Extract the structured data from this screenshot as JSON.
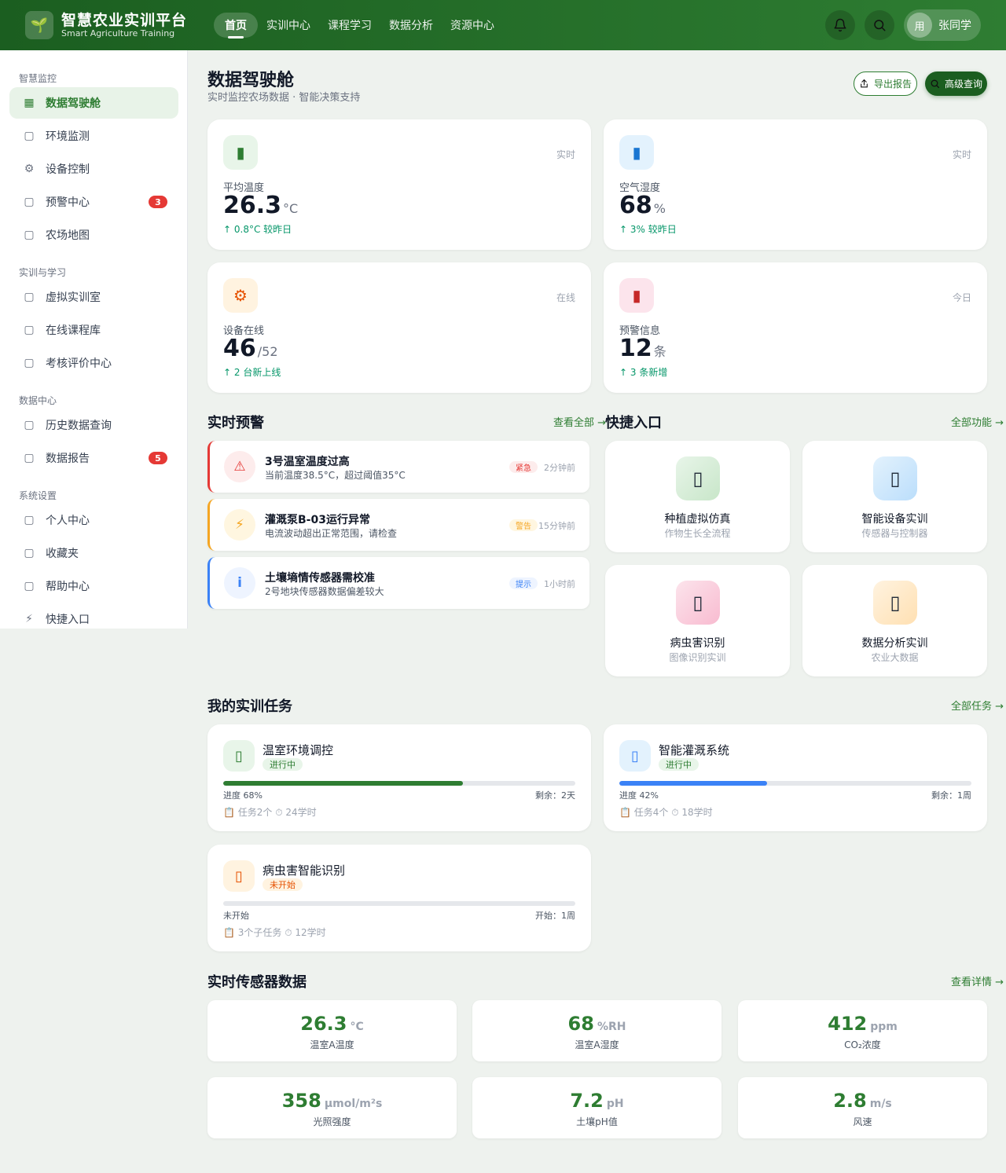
{
  "header": {
    "logo_icon": "leaf-icon",
    "title": "智慧农业实训平台",
    "subtitle": "Smart Agriculture Training",
    "tabs": [
      "首页",
      "实训中心",
      "课程学习",
      "数据分析",
      "资源中心"
    ],
    "active_tab": "首页",
    "user_avatar": "用",
    "user_name": "张同学"
  },
  "sidebar": {
    "sections": [
      {
        "title": "智慧监控"
      },
      {
        "title": "实训与学习"
      },
      {
        "title": "数据中心"
      },
      {
        "title": "系统设置"
      }
    ],
    "items": [
      {
        "icon": "dashboard-icon",
        "label": "数据驾驶舱"
      },
      {
        "icon": "camera-icon",
        "label": "环境监测"
      },
      {
        "icon": "gear-icon",
        "label": "设备控制"
      },
      {
        "icon": "bell-icon",
        "label": "预警中心",
        "badge": "3"
      },
      {
        "icon": "map-icon",
        "label": "农场地图"
      },
      {
        "icon": "flask-icon",
        "label": "虚拟实训室"
      },
      {
        "icon": "book-icon",
        "label": "在线课程库"
      },
      {
        "icon": "clipboard-icon",
        "label": "考核评价中心"
      },
      {
        "icon": "chart-icon",
        "label": "历史数据查询"
      },
      {
        "icon": "report-icon",
        "label": "数据报告",
        "badge": "5"
      },
      {
        "icon": "user-icon",
        "label": "个人中心"
      },
      {
        "icon": "star-icon",
        "label": "收藏夹"
      },
      {
        "icon": "help-icon",
        "label": "帮助中心"
      },
      {
        "icon": "lightning-icon",
        "label": "快捷入口"
      }
    ]
  },
  "page": {
    "title": "数据驾驶舱",
    "subtitle": "实时监控农场数据 · 智能决策支持",
    "export_label": "导出报告",
    "query_label": "高级查询"
  },
  "stats": [
    {
      "icon": "thermometer-icon",
      "tag": "实时",
      "label": "平均温度",
      "value": "26.3",
      "unit": "°C",
      "trend": "↑ 0.8°C 较昨日",
      "color": "#2e7d32",
      "bg": "#e8f5e9"
    },
    {
      "icon": "droplet-icon",
      "tag": "实时",
      "label": "空气湿度",
      "value": "68",
      "unit": "%",
      "trend": "↑ 3% 较昨日",
      "color": "#1976d2",
      "bg": "#e3f2fd"
    },
    {
      "icon": "gear-icon",
      "tag": "在线",
      "label": "设备在线",
      "value": "46",
      "unit": "/52",
      "trend": "↑ 2 台新上线",
      "color": "#e65100",
      "bg": "#fff3e0"
    },
    {
      "icon": "alert-icon",
      "tag": "今日",
      "label": "预警信息",
      "value": "12",
      "unit": "条",
      "trend": "↑ 3 条新增",
      "color": "#c62828",
      "bg": "#fce4ec"
    }
  ],
  "alerts_section": {
    "title": "实时预警",
    "link": "查看全部 →"
  },
  "alerts": [
    {
      "icon": "warning-icon",
      "glyph": "⚠",
      "title": "3号温室温度过高",
      "desc": "当前温度38.5°C，超过阈值35°C",
      "badge": "紧急",
      "time": "2分钟前",
      "color": "#e53935",
      "bg": "#fdecec"
    },
    {
      "icon": "lightning-icon",
      "glyph": "⚡",
      "title": "灌溉泵B-03运行异常",
      "desc": "电流波动超出正常范围，请检查",
      "badge": "警告",
      "time": "15分钟前",
      "color": "#f5a623",
      "bg": "#fff6e0"
    },
    {
      "icon": "info-icon",
      "glyph": "i",
      "title": "土壤墒情传感器需校准",
      "desc": "2号地块传感器数据偏差较大",
      "badge": "提示",
      "time": "1小时前",
      "color": "#3b82f6",
      "bg": "#eef4ff"
    }
  ],
  "quick_section": {
    "title": "快捷入口",
    "link": "全部功能 →"
  },
  "quick": [
    {
      "icon": "seedling-icon",
      "title": "种植虚拟仿真",
      "sub": "作物生长全流程",
      "bg": "linear-gradient(135deg,#e8f5e9,#c8e6c9)"
    },
    {
      "icon": "robot-icon",
      "title": "智能设备实训",
      "sub": "传感器与控制器",
      "bg": "linear-gradient(135deg,#e3f2fd,#bbdefb)"
    },
    {
      "icon": "microscope-icon",
      "title": "病虫害识别",
      "sub": "图像识别实训",
      "bg": "linear-gradient(135deg,#fce4ec,#f8bbd0)"
    },
    {
      "icon": "chart-icon",
      "title": "数据分析实训",
      "sub": "农业大数据",
      "bg": "linear-gradient(135deg,#fff3e0,#ffe0b2)"
    }
  ],
  "courses_section": {
    "title": "我的实训任务",
    "link": "全部任务 →"
  },
  "courses": [
    {
      "icon": "seedling-icon",
      "title": "温室环境调控",
      "status": "进行中",
      "progress": 0.68,
      "progress_label": "进度 68%",
      "remain": "剩余：2天",
      "meta": "📋 任务2个    ⏱ 24学时",
      "color": "#2e7d32",
      "bg": "#e8f5e9",
      "status_bg": "#e8f5e9",
      "status_color": "#2e7d32"
    },
    {
      "icon": "droplet-icon",
      "title": "智能灌溉系统",
      "status": "进行中",
      "progress": 0.42,
      "progress_label": "进度 42%",
      "remain": "剩余：1周",
      "meta": "📋 任务4个    ⏱ 18学时",
      "color": "#3b82f6",
      "bg": "#e3f2fd",
      "status_bg": "#e8f5e9",
      "status_color": "#2e7d32"
    },
    {
      "icon": "microscope-icon",
      "title": "病虫害智能识别",
      "status": "未开始",
      "progress": 0,
      "progress_label": "未开始",
      "remain": "开始：1周",
      "meta": "📋 3个子任务    ⏱ 12学时",
      "color": "#e65100",
      "bg": "#fff3e0",
      "status_bg": "#fff3e0",
      "status_color": "#e65100"
    }
  ],
  "sensors_section": {
    "title": "实时传感器数据",
    "link": "查看详情 →"
  },
  "sensors": [
    {
      "value": "26.3",
      "unit": "°C",
      "label": "温室A温度"
    },
    {
      "value": "68",
      "unit": "%RH",
      "label": "温室A湿度"
    },
    {
      "value": "412",
      "unit": "ppm",
      "label": "CO₂浓度"
    },
    {
      "value": "358",
      "unit": "μmol/m²s",
      "label": "光照强度"
    },
    {
      "value": "7.2",
      "unit": "pH",
      "label": "土壤pH值"
    },
    {
      "value": "2.8",
      "unit": "m/s",
      "label": "风速"
    }
  ]
}
